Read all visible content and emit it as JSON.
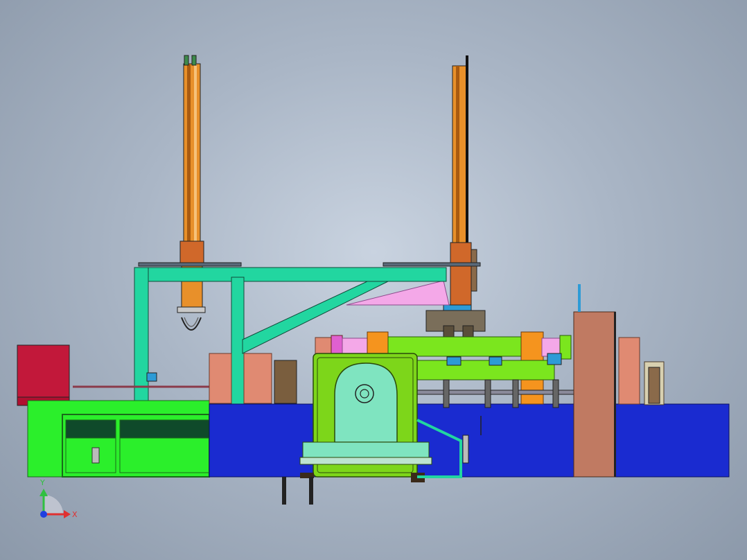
{
  "viewport": {
    "background": "cad-gradient"
  },
  "triad": {
    "x_label": "X",
    "y_label": "Y",
    "x_color": "#e03030",
    "y_color": "#30c040",
    "z_color": "#2040e0"
  },
  "palette": {
    "frame": "#22d6a0",
    "base_green": "#2bef2b",
    "base_blue": "#1a2bd0",
    "press_body": "#7dd61a",
    "press_window": "#7fe4c0",
    "roller": "#7be61e",
    "column_orange": "#e8902a",
    "cabinet_red": "#c2183a",
    "salmon": "#e08a72",
    "pink": "#f4a8e8",
    "brown": "#8a6a4a",
    "pillar": "#c07a62"
  }
}
